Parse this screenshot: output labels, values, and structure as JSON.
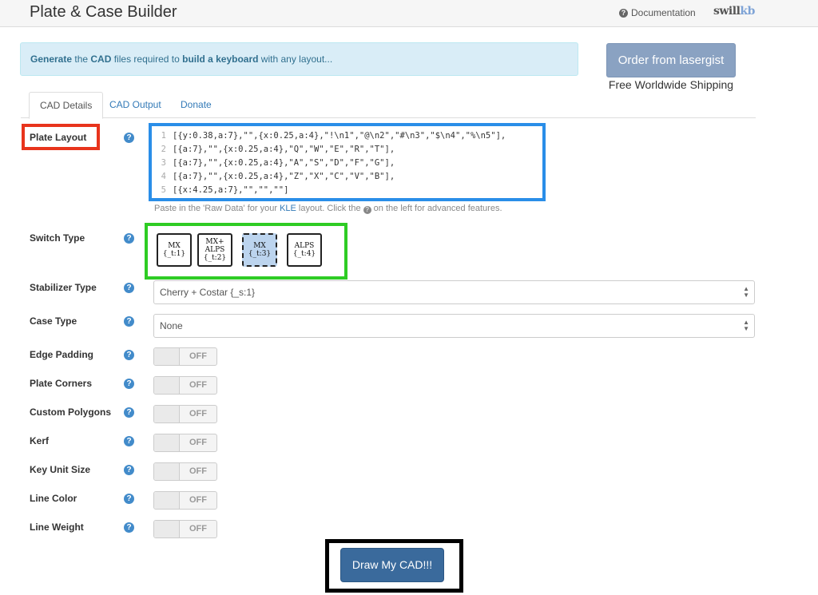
{
  "header": {
    "title": "Plate & Case Builder",
    "documentation_label": "Documentation",
    "brand_prefix": "swill",
    "brand_suffix": "kb"
  },
  "banner": {
    "part1": "Generate",
    "part2": " the ",
    "part3": "CAD",
    "part4": " files required to ",
    "part5": "build a keyboard",
    "part6": " with any layout..."
  },
  "order": {
    "button_label": "Order from lasergist",
    "shipping_note": "Free Worldwide Shipping"
  },
  "tabs": [
    {
      "label": "CAD Details"
    },
    {
      "label": "CAD Output"
    },
    {
      "label": "Donate"
    }
  ],
  "plate_layout": {
    "label": "Plate Layout",
    "lines": [
      {
        "n": "1",
        "text": "[{y:0.38,a:7},\"\",{x:0.25,a:4},\"!\\n1\",\"@\\n2\",\"#\\n3\",\"$\\n4\",\"%\\n5\"],"
      },
      {
        "n": "2",
        "text": "[{a:7},\"\",{x:0.25,a:4},\"Q\",\"W\",\"E\",\"R\",\"T\"],"
      },
      {
        "n": "3",
        "text": "[{a:7},\"\",{x:0.25,a:4},\"A\",\"S\",\"D\",\"F\",\"G\"],"
      },
      {
        "n": "4",
        "text": "[{a:7},\"\",{x:0.25,a:4},\"Z\",\"X\",\"C\",\"V\",\"B\"],"
      },
      {
        "n": "5",
        "text": "[{x:4.25,a:7},\"\",\"\",\"\"]"
      }
    ],
    "hint_before": "Paste in the 'Raw Data' for your ",
    "hint_link": "KLE",
    "hint_mid": " layout. Click the ",
    "hint_after": " on the left for advanced features."
  },
  "switch_type": {
    "label": "Switch Type",
    "options": [
      {
        "l1": "MX",
        "l2": "{_t:1}",
        "l3": ""
      },
      {
        "l1": "MX+",
        "l2": "ALPS",
        "l3": "{_t:2}"
      },
      {
        "l1": "MX",
        "l2": "{_t:3}",
        "l3": ""
      },
      {
        "l1": "ALPS",
        "l2": "{_t:4}",
        "l3": ""
      }
    ],
    "selected_index": 2
  },
  "stabilizer": {
    "label": "Stabilizer Type",
    "value": "Cherry + Costar {_s:1}"
  },
  "case_type": {
    "label": "Case Type",
    "value": "None"
  },
  "toggles": [
    {
      "label": "Edge Padding",
      "state": "OFF"
    },
    {
      "label": "Plate Corners",
      "state": "OFF"
    },
    {
      "label": "Custom Polygons",
      "state": "OFF"
    },
    {
      "label": "Kerf",
      "state": "OFF"
    },
    {
      "label": "Key Unit Size",
      "state": "OFF"
    },
    {
      "label": "Line Color",
      "state": "OFF"
    },
    {
      "label": "Line Weight",
      "state": "OFF"
    }
  ],
  "help_glyph": "?",
  "draw_button_label": "Draw My CAD!!!",
  "colors": {
    "banner_bg": "#d9edf7",
    "primary": "#3a6a9c",
    "help_blue": "#428bca",
    "highlight_red": "#e8341c",
    "highlight_blue": "#2a8ee8",
    "highlight_green": "#2ecc24"
  }
}
